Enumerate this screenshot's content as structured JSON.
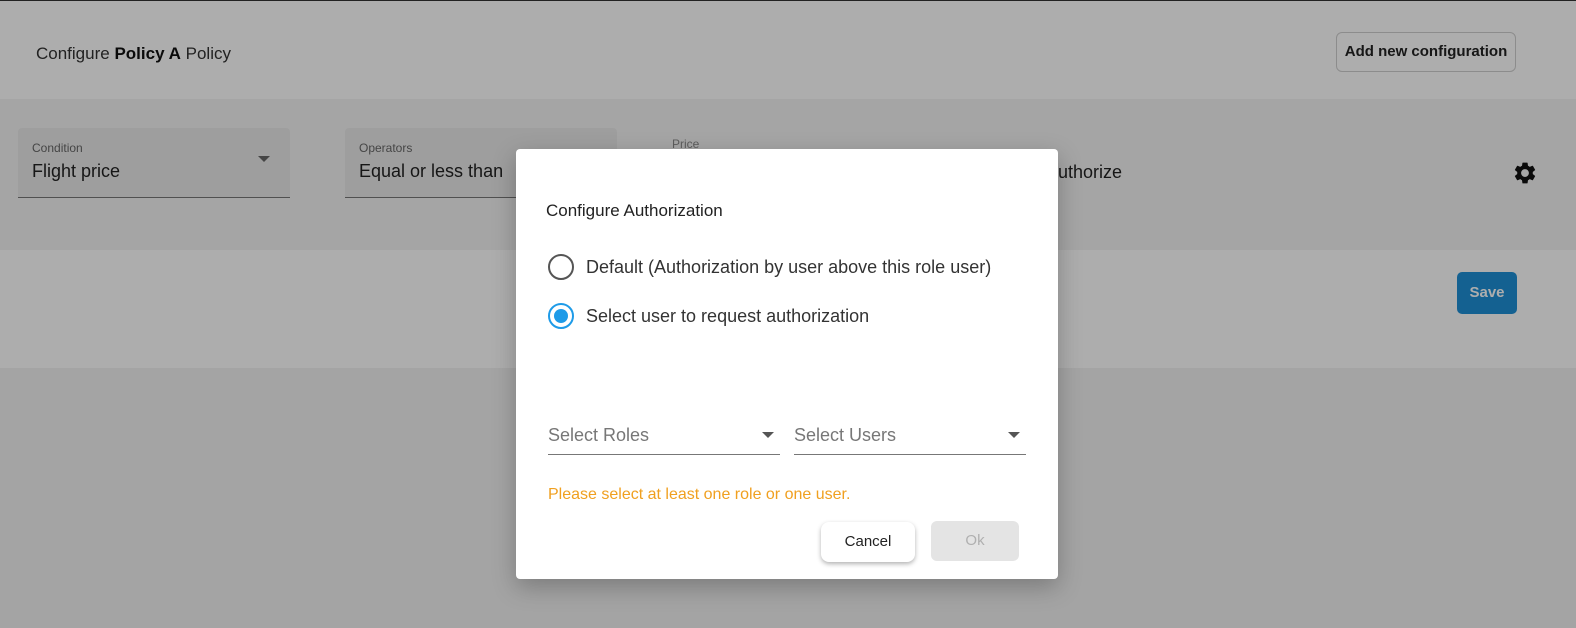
{
  "header": {
    "title_prefix": "Configure",
    "title_policy": "Policy A",
    "title_suffix": "Policy",
    "add_button_label": "Add new configuration"
  },
  "condition_row": {
    "condition": {
      "label": "Condition",
      "value": "Flight price"
    },
    "operators": {
      "label": "Operators",
      "value": "Equal or less than"
    },
    "price": {
      "label": "Price"
    },
    "action_text": "authorize",
    "settings_icon": "gear-icon"
  },
  "save_button_label": "Save",
  "colors": {
    "accent": "#1e9be8",
    "save_button": "#1e8fd6",
    "warning": "#f0a020"
  },
  "dialog": {
    "title": "Configure Authorization",
    "options": [
      {
        "label": "Default (Authorization by user above this role user)",
        "selected": false
      },
      {
        "label": "Select user to request authorization",
        "selected": true
      }
    ],
    "roles_select": {
      "placeholder": "Select Roles"
    },
    "users_select": {
      "placeholder": "Select Users"
    },
    "warning": "Please select at least one role or one user.",
    "cancel_label": "Cancel",
    "ok_label": "Ok"
  }
}
